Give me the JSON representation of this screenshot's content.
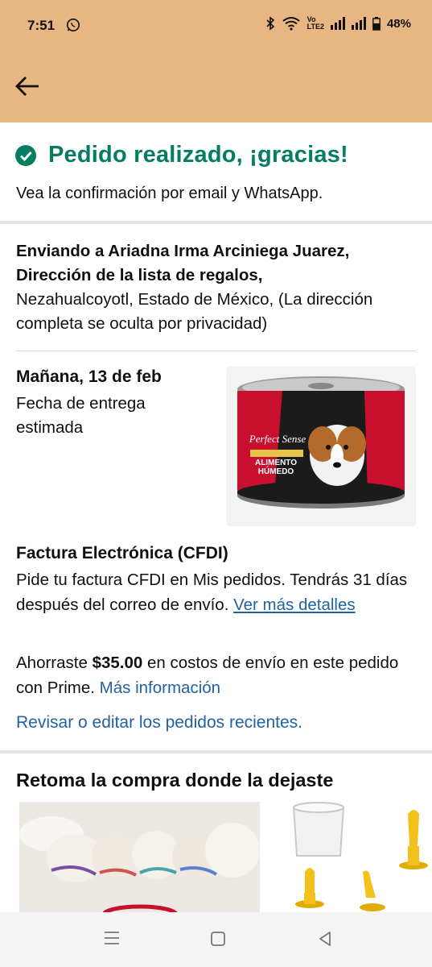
{
  "status_bar": {
    "time": "7:51",
    "network_top": "Vo",
    "network_bottom": "LTE2",
    "battery": "48%"
  },
  "header": {
    "back_icon": "arrow-left-icon"
  },
  "confirmation": {
    "title": "Pedido realizado, ¡gracias!",
    "subtitle": "Vea la confirmación por email y WhatsApp."
  },
  "shipping": {
    "line1": "Enviando a Ariadna Irma Arciniega Juarez,",
    "line2": "Dirección de la lista de regalos,",
    "line3": "Nezahualcoyotl, Estado de México, (La dirección completa se oculta por privacidad)"
  },
  "delivery": {
    "date": "Mañana, 13 de feb",
    "label": "Fecha de entrega estimada",
    "product_image": {
      "brand": "Perfect Sense",
      "line1": "ALIMENTO",
      "line2": "HÚMEDO"
    }
  },
  "invoice": {
    "title": "Factura Electrónica (CFDI)",
    "text": "Pide tu factura CFDI en Mis pedidos. Tendrás 31 días después del correo de envío. ",
    "link": "Ver más detalles"
  },
  "savings": {
    "prefix": "Ahorraste ",
    "amount": "$35.00",
    "suffix": " en costos de envío en este pedido con Prime. ",
    "link": "Más información"
  },
  "review_link": "Revisar o editar los pedidos recientes.",
  "recommendations": {
    "title": "Retoma la compra donde la dejaste"
  },
  "nav_bar": {
    "icons": [
      "recents-icon",
      "home-icon",
      "back-icon"
    ]
  },
  "colors": {
    "header_bg": "#e8b683",
    "success_green": "#067d62",
    "link_blue": "#2162a1"
  }
}
